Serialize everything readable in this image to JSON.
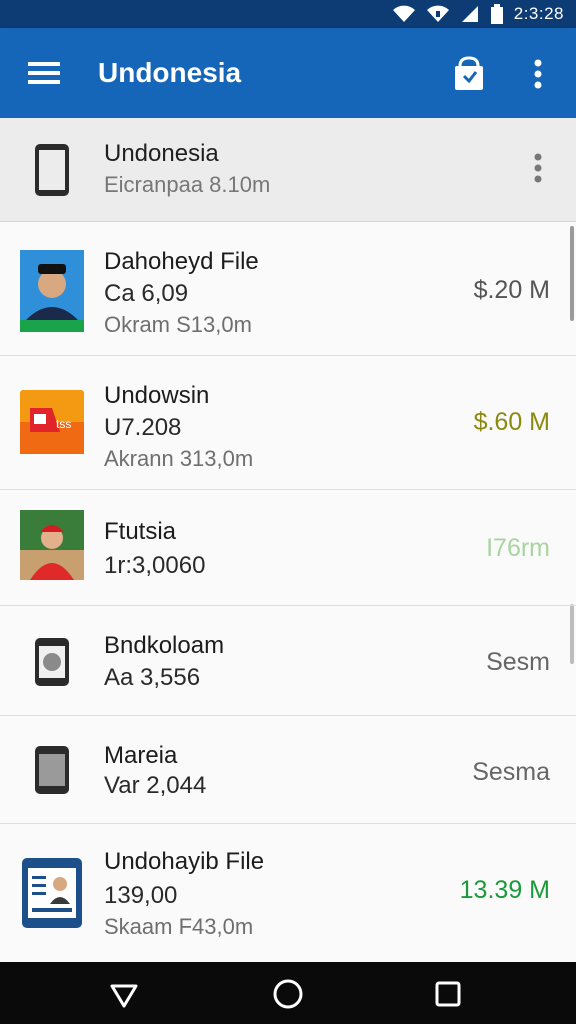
{
  "status_bar": {
    "time": "2:3:28",
    "icons": [
      "wifi-icon",
      "signal-icon",
      "battery-icon"
    ]
  },
  "app_bar": {
    "title": "Undonesia",
    "icons": [
      "hamburger-menu-icon",
      "share-bag-icon",
      "overflow-menu-icon"
    ],
    "color": "#1565b8"
  },
  "device_header": {
    "name": "Undonesia",
    "subtitle": "Eicranpaa 8.10m",
    "icons": [
      "phone-icon",
      "overflow-menu-icon"
    ]
  },
  "files": [
    {
      "title": "Dahoheyd File",
      "line2": "Ca 6,09",
      "line3": "Okram S13,0m",
      "size": "$.20 M",
      "size_color": "#555555",
      "thumb": "person-photo-icon"
    },
    {
      "title": "Undowsin",
      "line2": "U7.208",
      "line3": "Akrann 313,0m",
      "size": "$.60 M",
      "size_color": "#8a8a10",
      "thumb": "app-logo-icon"
    },
    {
      "title": "Ftutsia",
      "line2": "1r:3,0060",
      "line3": "",
      "size": "I76rm",
      "size_color": "#a9d4a0",
      "thumb": "child-photo-icon"
    },
    {
      "title": "Bndkoloam",
      "line2": "Aa 3,556",
      "line3": "",
      "size": "Sesm",
      "size_color": "#666666",
      "thumb": "phone-device-icon"
    },
    {
      "title": "Mareia",
      "line2": "Var 2,044",
      "line3": "",
      "size": "Sesma",
      "size_color": "#666666",
      "thumb": "phone-device-icon"
    },
    {
      "title": "Undohayib File",
      "line2": "139,00",
      "line3": "Skaam F43,0m",
      "size": "13.39 M",
      "size_color": "#1a9a3a",
      "thumb": "id-card-icon"
    }
  ],
  "nav_bar": {
    "icons": [
      "back-icon",
      "home-icon",
      "recents-icon"
    ]
  }
}
